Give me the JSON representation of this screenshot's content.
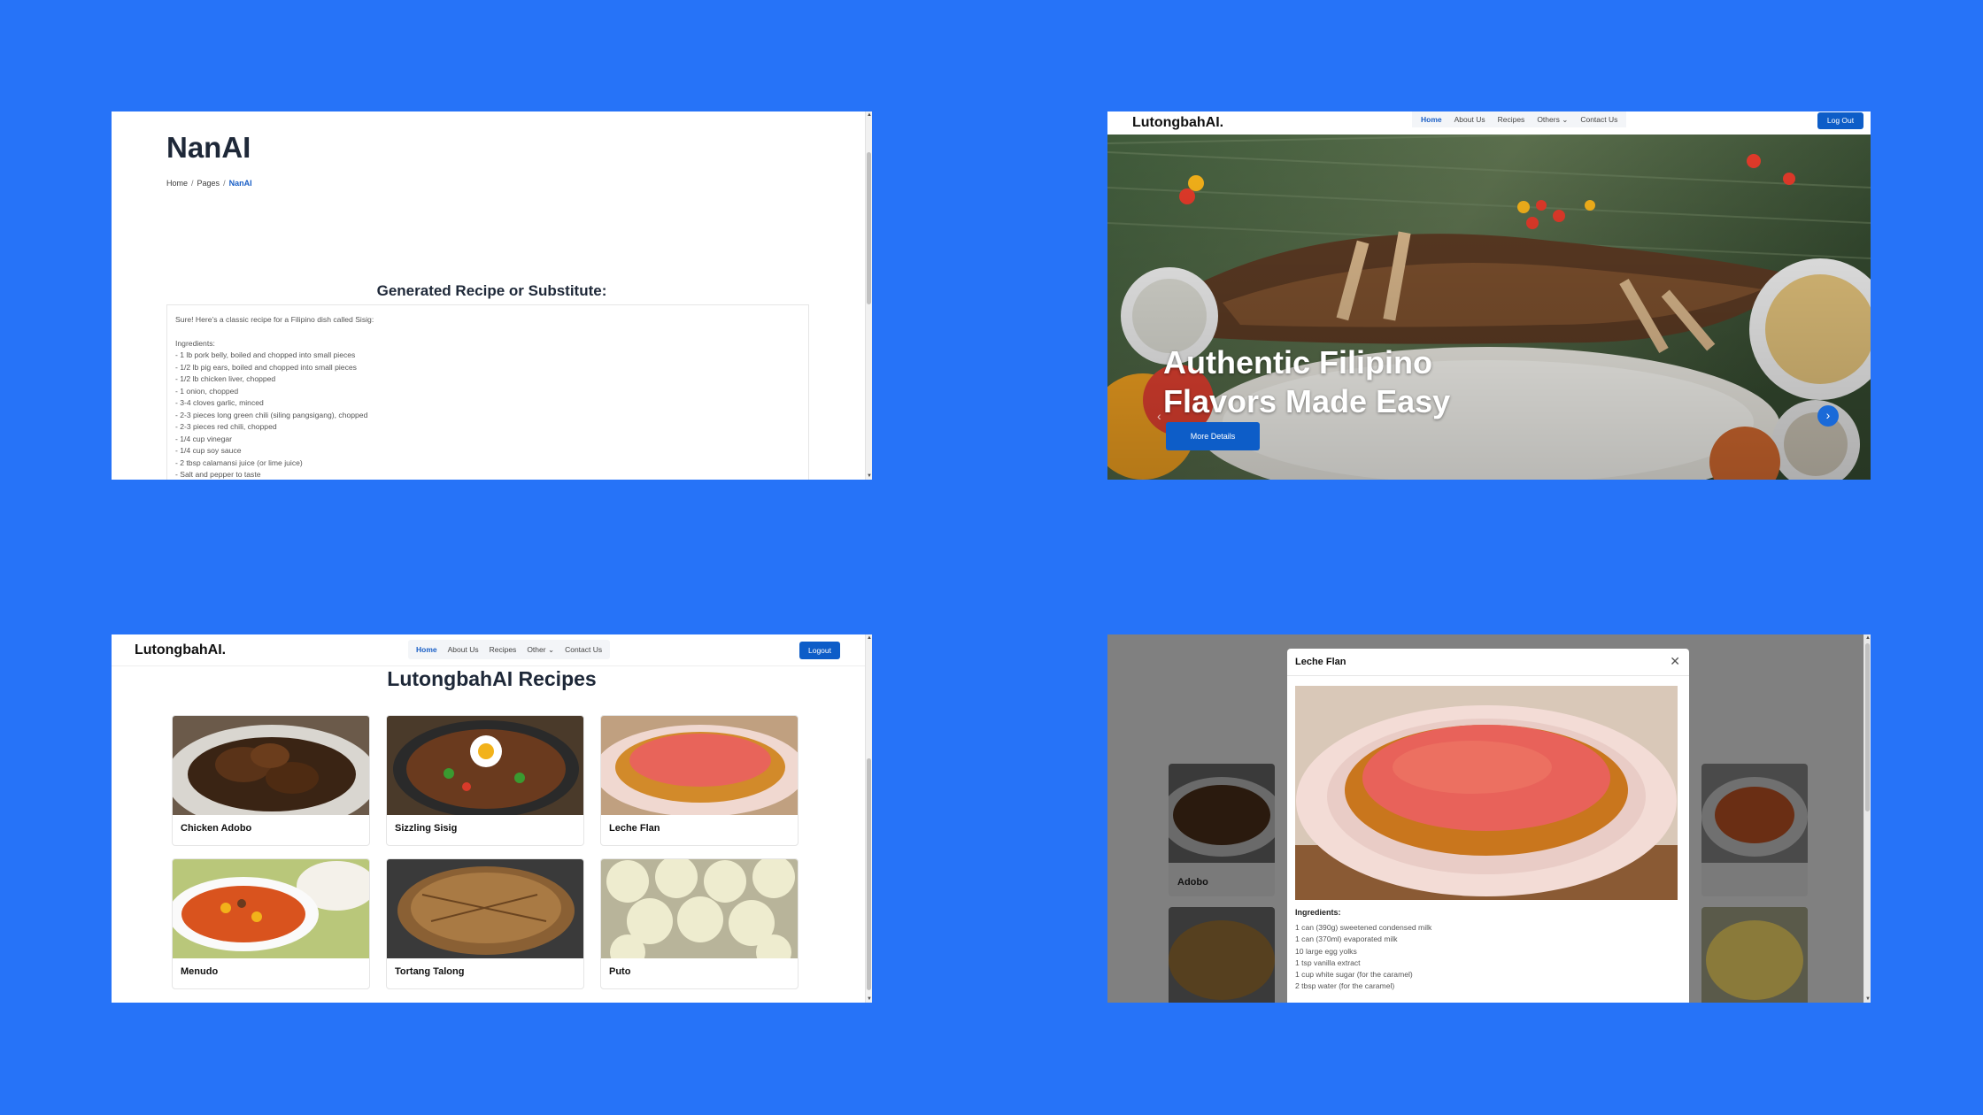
{
  "colors": {
    "background": "#2673f8",
    "accent": "#0d5dc8",
    "modal_overlay": "#808080"
  },
  "nanai_page": {
    "title": "NanAI",
    "breadcrumb": [
      "Home",
      "Pages",
      "NanAI"
    ],
    "generated_heading": "Generated Recipe or Substitute:",
    "intro": "Sure! Here's a classic recipe for a Filipino dish called Sisig:",
    "ingredients_label": "Ingredients:",
    "ingredients": [
      "- 1 lb pork belly, boiled and chopped into small pieces",
      "- 1/2 lb pig ears, boiled and chopped into small pieces",
      "- 1/2 lb chicken liver, chopped",
      "- 1 onion, chopped",
      "- 3-4 cloves garlic, minced",
      "- 2-3 pieces long green chili (siling pangsigang), chopped",
      "- 2-3 pieces red chili, chopped",
      "- 1/4 cup vinegar",
      "- 1/4 cup soy sauce",
      "- 2 tbsp calamansi juice (or lime juice)",
      "- Salt and pepper to taste"
    ]
  },
  "home_page": {
    "brand": "LutongbahAI.",
    "nav": [
      "Home",
      "About Us",
      "Recipes",
      "Others",
      "Contact Us"
    ],
    "logout": "Log Out",
    "hero_line1": "Authentic Filipino",
    "hero_line2": "Flavors Made Easy",
    "hero_button": "More Details"
  },
  "recipes_page": {
    "brand": "LutongbahAI.",
    "nav": [
      "Home",
      "About Us",
      "Recipes",
      "Other",
      "Contact Us"
    ],
    "logout": "Logout",
    "title": "LutongbahAI Recipes",
    "recipes": [
      "Chicken Adobo",
      "Sizzling Sisig",
      "Leche Flan",
      "Menudo",
      "Tortang Talong",
      "Puto"
    ]
  },
  "modal_page": {
    "background_card_label": "Adobo",
    "modal_title": "Leche Flan",
    "ingredients_label": "Ingredients:",
    "ingredients": [
      "1 can (390g) sweetened condensed milk",
      "1 can (370ml) evaporated milk",
      "10 large egg yolks",
      "1 tsp vanilla extract",
      "1 cup white sugar (for the caramel)",
      "2 tbsp water (for the caramel)"
    ]
  }
}
